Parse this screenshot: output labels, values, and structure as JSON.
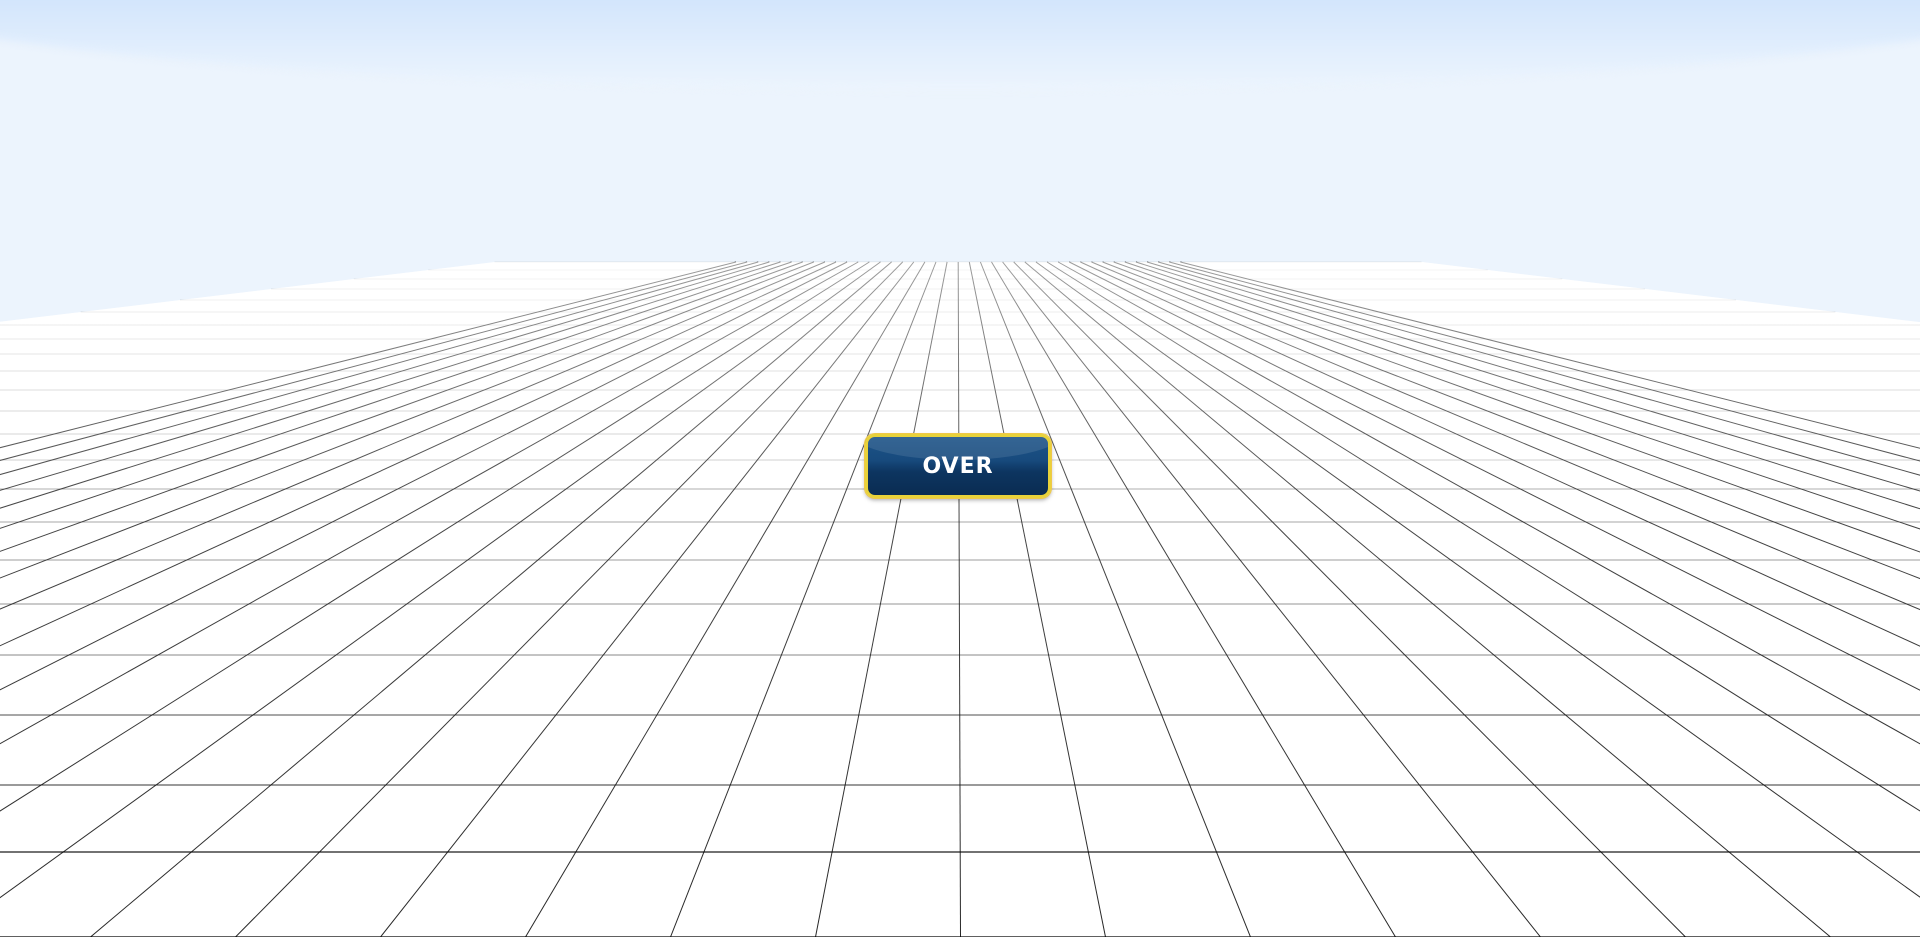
{
  "scene": {
    "sky_color": "#ecf4fd",
    "sky_band_color": "#bcd8fa",
    "floor_color": "#ffffff",
    "grid_line_color": "#000000"
  },
  "over_button": {
    "label": "OVER",
    "bg_color": "#174a7d",
    "border_color": "#e8d23a"
  }
}
